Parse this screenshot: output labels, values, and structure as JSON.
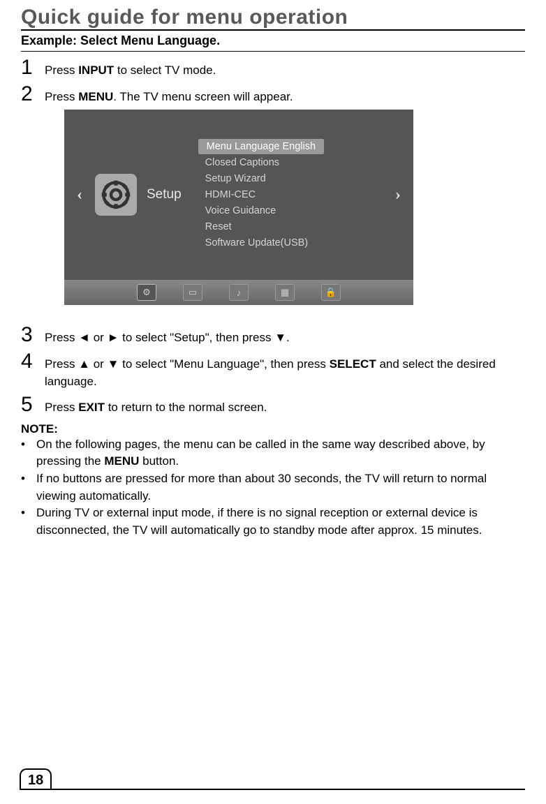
{
  "title": "Quick guide for menu operation",
  "subtitle": "Example: Select Menu Language.",
  "steps": {
    "s1": {
      "num": "1",
      "pre": "Press ",
      "b1": "INPUT",
      "post": " to select TV mode."
    },
    "s2": {
      "num": "2",
      "pre": "Press ",
      "b1": "MENU",
      "post": ". The TV menu screen will appear."
    },
    "s3": {
      "num": "3",
      "text": "Press ◄ or ► to select \"Setup\", then press ▼."
    },
    "s4": {
      "num": "4",
      "pre": "Press ▲ or ▼ to select \"Menu Language\", then press ",
      "b1": "SELECT",
      "post": " and select the desired language."
    },
    "s5": {
      "num": "5",
      "pre": "Press ",
      "b1": "EXIT",
      "post": " to return to the normal screen."
    }
  },
  "screenshot": {
    "setup_label": "Setup",
    "left_arrow": "‹",
    "right_arrow": "›",
    "menu_items": {
      "i0": "Menu Language English",
      "i1": "Closed Captions",
      "i2": "Setup Wizard",
      "i3": "HDMI-CEC",
      "i4": "Voice Guidance",
      "i5": "Reset",
      "i6": "Software Update(USB)"
    },
    "bar_icons": {
      "b0": "⚙",
      "b1": "▭",
      "b2": "♪",
      "b3": "▦",
      "b4": "🔒"
    }
  },
  "note_heading": "NOTE:",
  "notes": {
    "n1": {
      "pre": "On the following pages, the menu can be called in the same way described above, by pressing the ",
      "b1": "MENU",
      "post": " button."
    },
    "n2": {
      "text": "If no buttons are pressed for more than about 30 seconds, the TV will return to normal viewing automatically."
    },
    "n3": {
      "text": "During TV or external input mode, if there is no signal reception or external device is disconnected, the TV will automatically go to standby mode after approx. 15 minutes."
    }
  },
  "bullet": "•",
  "page_number": "18"
}
